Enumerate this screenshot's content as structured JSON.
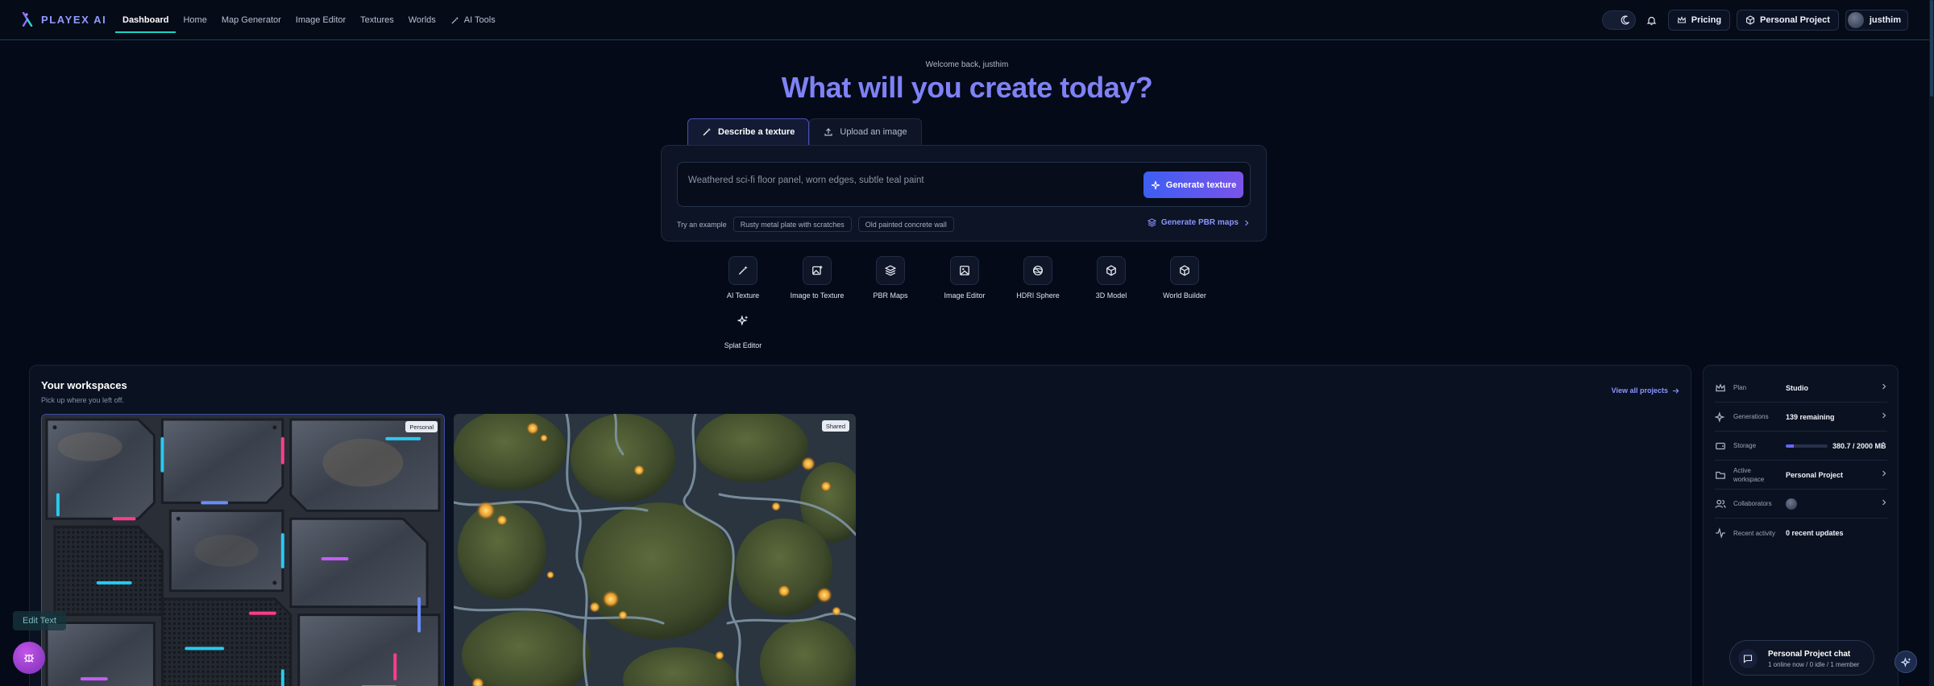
{
  "app": {
    "brand": "PLAYEX AI"
  },
  "nav": {
    "items": [
      {
        "label": "Dashboard",
        "active": true
      },
      {
        "label": "Home"
      },
      {
        "label": "Map Generator"
      },
      {
        "label": "Image Editor"
      },
      {
        "label": "Textures"
      },
      {
        "label": "Worlds"
      },
      {
        "label": "AI Tools",
        "icon": "wand-icon"
      }
    ]
  },
  "header_right": {
    "pricing_label": "Pricing",
    "project_label": "Personal Project",
    "username": "justhim"
  },
  "hero": {
    "welcome": "Welcome back, justhim",
    "headline": "What will you create today?"
  },
  "tabs": [
    {
      "label": "Describe a texture",
      "active": true
    },
    {
      "label": "Upload an image"
    }
  ],
  "composer": {
    "placeholder": "Weathered sci-fi floor panel, worn edges, subtle teal paint",
    "value": "",
    "generate_label": "Generate texture",
    "examples_label": "Try an example",
    "examples": [
      "Rusty metal plate with scratches",
      "Old painted concrete wall"
    ],
    "pbr_link": "Generate PBR maps"
  },
  "tools": [
    {
      "label": "AI Texture",
      "icon": "wand-icon"
    },
    {
      "label": "Image to Texture",
      "icon": "image-plus-icon"
    },
    {
      "label": "PBR Maps",
      "icon": "layers-icon"
    },
    {
      "label": "Image Editor",
      "icon": "image-icon"
    },
    {
      "label": "HDRI Sphere",
      "icon": "globe-icon"
    },
    {
      "label": "3D Model",
      "icon": "cube-icon"
    },
    {
      "label": "World Builder",
      "icon": "box-icon"
    },
    {
      "label": "Splat Editor",
      "icon": "sparkles-icon"
    }
  ],
  "workspaces": {
    "title": "Your workspaces",
    "subtitle": "Pick up where you left off.",
    "view_all": "View all projects",
    "cards": [
      {
        "badge": "Personal"
      },
      {
        "badge": "Shared"
      }
    ]
  },
  "stats": {
    "rows": [
      {
        "label": "Plan",
        "value": "Studio",
        "icon": "crown-icon"
      },
      {
        "label": "Generations",
        "value": "139 remaining",
        "icon": "sparkles-icon"
      },
      {
        "label": "Storage",
        "value": "380.7 / 2000 MB",
        "icon": "hard-drive-icon",
        "used_fraction": 0.19
      },
      {
        "label": "Active workspace",
        "value": "Personal Project",
        "icon": "folder-icon"
      },
      {
        "label": "Collaborators",
        "value": "",
        "icon": "users-icon"
      },
      {
        "label": "Recent activity",
        "value": "0 recent updates",
        "icon": "activity-icon"
      }
    ]
  },
  "chat": {
    "title": "Personal Project chat",
    "subtitle": "1 online now / 0 idle / 1 member"
  },
  "floating": {
    "edit_text": "Edit Text"
  },
  "colors": {
    "accent_indigo": "#7f82f5",
    "accent_teal": "#19d3c5",
    "background": "#050a18"
  }
}
